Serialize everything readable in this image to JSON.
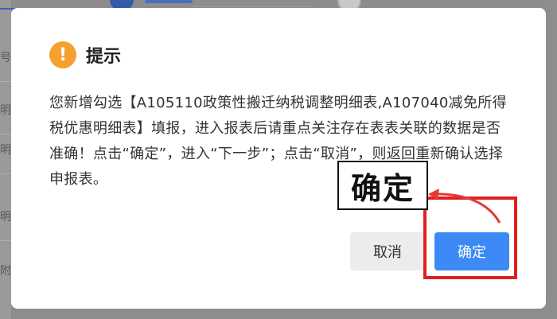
{
  "background": {
    "edge_chars": [
      "号",
      "明",
      "明",
      "明",
      "附"
    ]
  },
  "dialog": {
    "icon": "warning-icon",
    "title": "提示",
    "message": "您新增勾选【A105110政策性搬迁纳税调整明细表,A107040减免所得税优惠明细表】填报，进入报表后请重点关注存在表表关联的数据是否准确！点击“确定”，进入“下一步”；点击“取消”，则返回重新确认选择申报表。",
    "cancel_label": "取消",
    "confirm_label": "确定"
  },
  "annotation": {
    "callout_text": "确定",
    "highlight_color": "#e02020"
  },
  "colors": {
    "accent": "#3d8af7",
    "warning": "#f5a130"
  }
}
